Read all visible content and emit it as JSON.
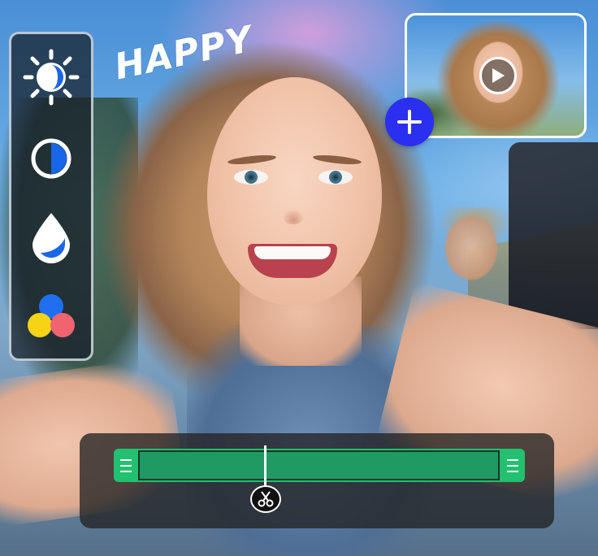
{
  "sticker": {
    "text": "HAPPY"
  },
  "tools": [
    {
      "name": "brightness-icon"
    },
    {
      "name": "contrast-icon"
    },
    {
      "name": "saturation-icon"
    },
    {
      "name": "color-icon"
    }
  ],
  "pip": {
    "icons": [
      "play-icon"
    ],
    "add_icon": "plus-icon"
  },
  "timeline": {
    "cut_icon": "scissors-icon"
  },
  "colors": {
    "accent_add": "#2a2ff0",
    "clip_green": "#22c06f",
    "clip_body": "#1f9a62",
    "tool_blue": "#1a66e8",
    "color_dot_blue": "#1f6ff0",
    "color_dot_yellow": "#f7d316",
    "color_dot_red": "#f06470"
  }
}
